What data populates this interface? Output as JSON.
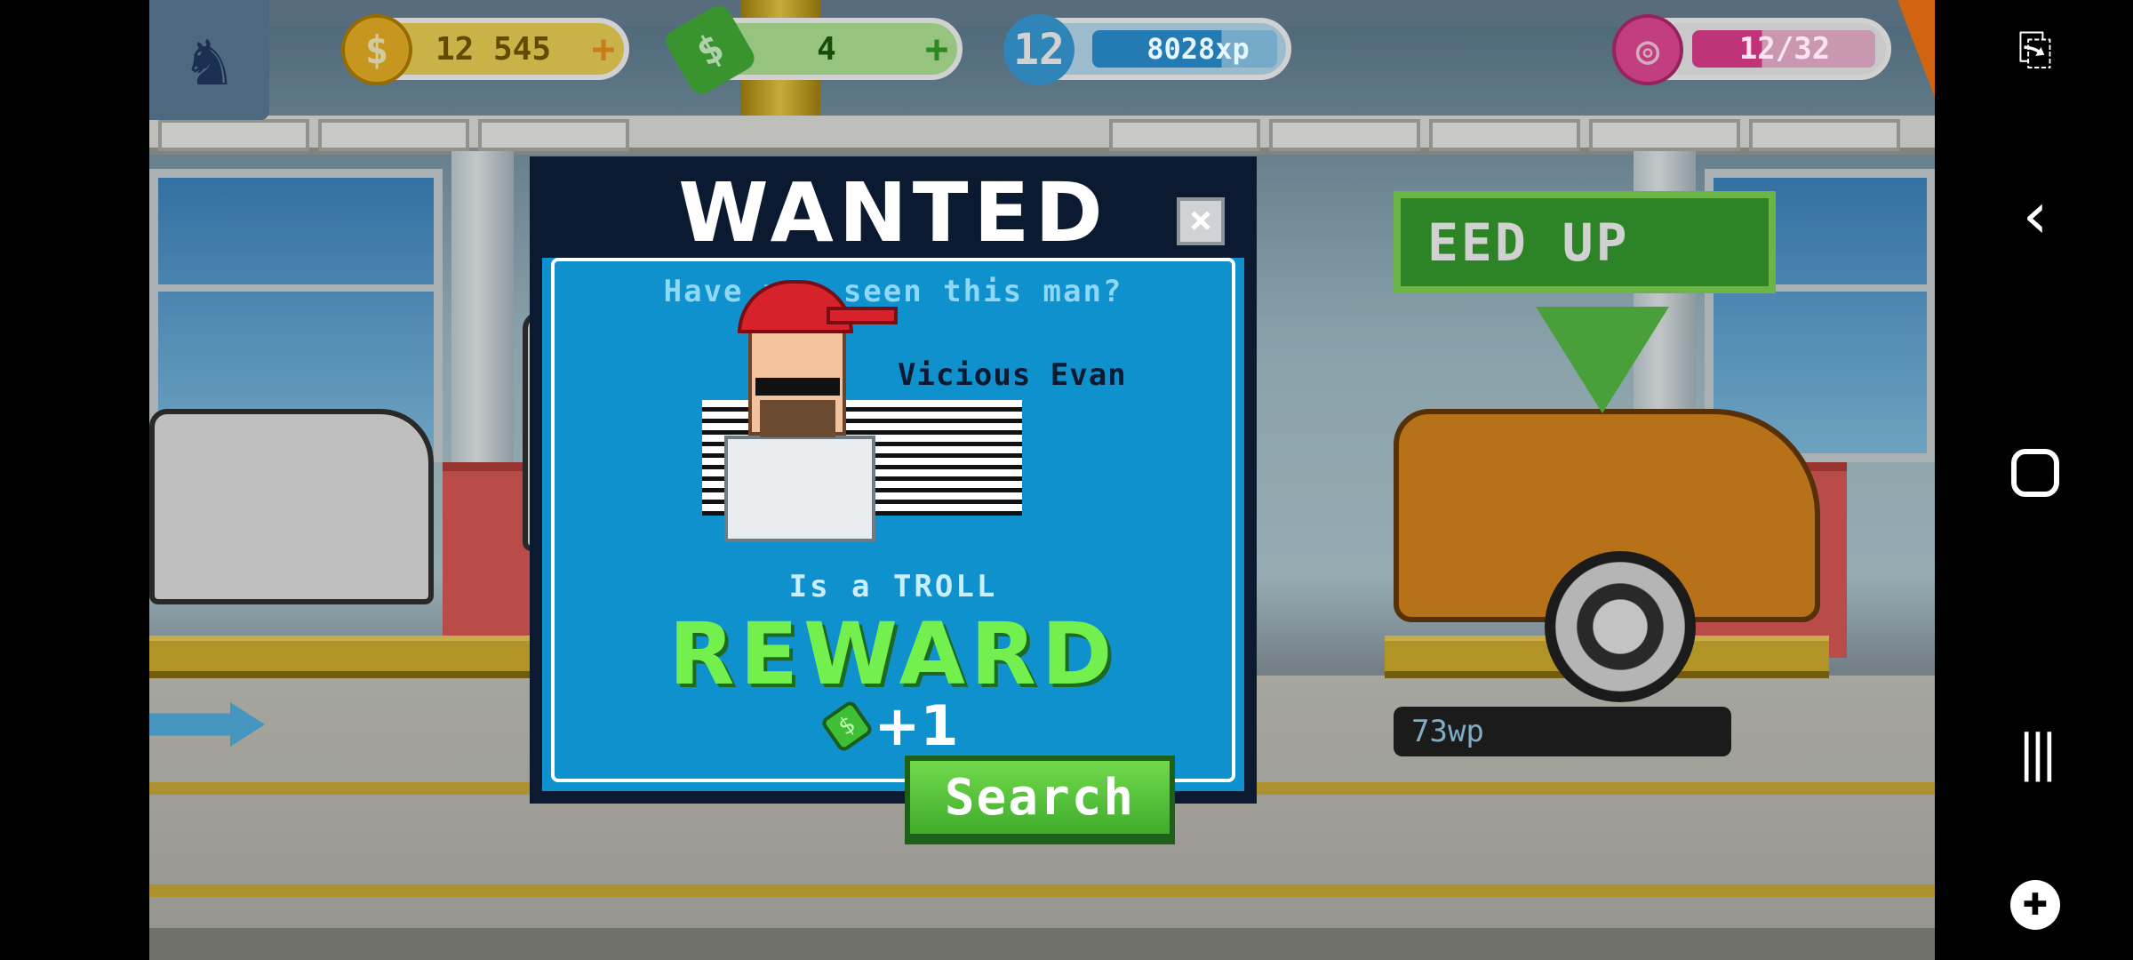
{
  "hud": {
    "coins": "12 545",
    "cash": "4",
    "level": "12",
    "xp": "8028xp",
    "donuts": "12/32",
    "plus_symbol": "+"
  },
  "background": {
    "speed_up_label": "EED UP",
    "xp_bar_label": "73wp"
  },
  "wanted": {
    "title": "WANTED",
    "close_symbol": "×",
    "question": "Have you seen this man?",
    "suspect_name": "Vicious Evan",
    "crime": "Is a TROLL",
    "reward_label": "REWARD",
    "reward_amount": "+1",
    "reward_icon": "cash-icon",
    "search_label": "Search"
  },
  "navbar": {
    "items": [
      "screenshot-icon",
      "back-icon",
      "home-icon",
      "recents-icon",
      "game-launcher-icon"
    ]
  },
  "colors": {
    "modal_bg": "#0e91cd",
    "modal_header": "#0b1a31",
    "reward_green": "#73f04e",
    "button_green": "#3fac2b"
  }
}
